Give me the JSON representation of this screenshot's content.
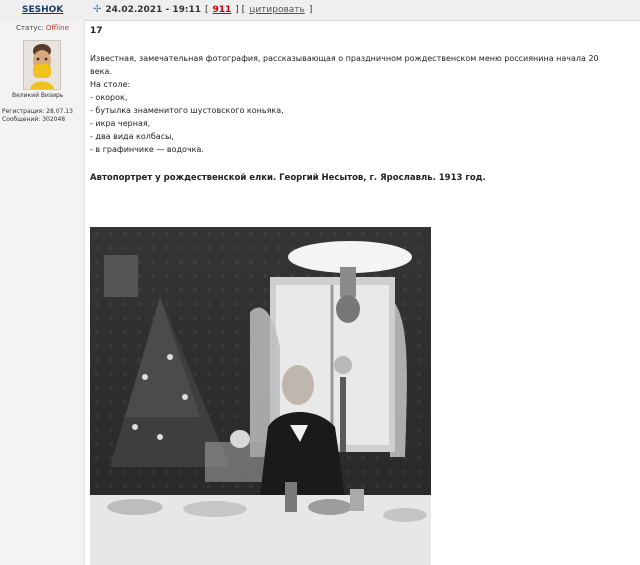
{
  "author": {
    "username": "SESHOK",
    "status_label": "Статус:",
    "status_value": "Offline",
    "title": "Великий Визирь",
    "registration": "Регистрация: 28.07.13",
    "messages": "Сообщений: 302048"
  },
  "post_meta": {
    "datetime": "24.02.2021 - 19:11",
    "open_bracket": "[",
    "post_link": "911",
    "separator": "] [",
    "quote": "цитировать",
    "close_bracket": "]"
  },
  "post": {
    "number": "17",
    "lines": [
      "Известная, замечательная фотография, рассказывающая о праздничном рождественском меню россиянина начала 20",
      "века.",
      "На столе:",
      "- окорок,",
      "- бутылка знаменитого шустовского коньяка,",
      "- икра черная,",
      "- два вида колбасы,",
      "- в графинчике — водочка."
    ],
    "caption": "Автопортрет у рождественской елки. Георгий Несытов, г. Ярославль. 1913 год."
  },
  "colors": {
    "header_bg": "#efefef",
    "sidebar_bg": "#f3f3f3",
    "link": "#1d3b6a",
    "offline": "#c0392b",
    "post_link": "#cc0000"
  }
}
